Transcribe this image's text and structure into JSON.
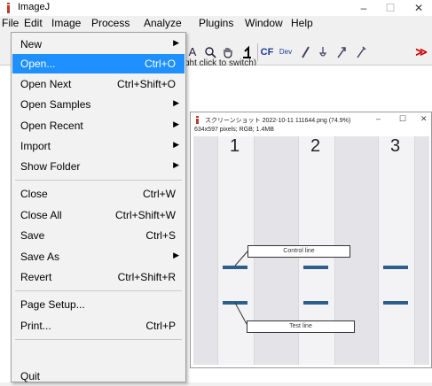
{
  "window": {
    "title": "ImageJ",
    "minimize": "–",
    "maximize": "☐",
    "close": "✕"
  },
  "menubar": [
    "File",
    "Edit",
    "Image",
    "Process",
    "Analyze",
    "Plugins",
    "Window",
    "Help"
  ],
  "toolbar": {
    "tools": [
      "A",
      "🔍",
      "✋",
      "⌐",
      "CF",
      "Dev",
      "✎",
      "⊕",
      "✐",
      "✑",
      "≫"
    ]
  },
  "status_text": "ght click to switch)",
  "image_window": {
    "title": "スクリーンショット 2022-10-11 111644.png (74.9%)",
    "info": "634x597 pixels; RGB; 1.4MB",
    "strip_labels": [
      "1",
      "2",
      "3"
    ],
    "control_label": "Control line",
    "test_label": "Test line",
    "band_color": "#2d5f8a"
  },
  "file_menu": {
    "items": [
      {
        "label": "New",
        "shortcut": "",
        "submenu": true
      },
      {
        "label": "Open...",
        "shortcut": "Ctrl+O",
        "submenu": false,
        "highlighted": true
      },
      {
        "label": "Open Next",
        "shortcut": "Ctrl+Shift+O",
        "submenu": false
      },
      {
        "label": "Open Samples",
        "shortcut": "",
        "submenu": true
      },
      {
        "label": "Open Recent",
        "shortcut": "",
        "submenu": true
      },
      {
        "label": "Import",
        "shortcut": "",
        "submenu": true
      },
      {
        "label": "Show Folder",
        "shortcut": "",
        "submenu": true
      },
      {
        "label": "Close",
        "shortcut": "Ctrl+W",
        "submenu": false
      },
      {
        "label": "Close All",
        "shortcut": "Ctrl+Shift+W",
        "submenu": false
      },
      {
        "label": "Save",
        "shortcut": "Ctrl+S",
        "submenu": false
      },
      {
        "label": "Save As",
        "shortcut": "",
        "submenu": true
      },
      {
        "label": "Revert",
        "shortcut": "Ctrl+Shift+R",
        "submenu": false
      },
      {
        "label": "Page Setup...",
        "shortcut": "",
        "submenu": false
      },
      {
        "label": "Print...",
        "shortcut": "Ctrl+P",
        "submenu": false
      },
      {
        "label": "Quit",
        "shortcut": "",
        "submenu": false
      }
    ],
    "highlight_color": "#1e90ff"
  }
}
